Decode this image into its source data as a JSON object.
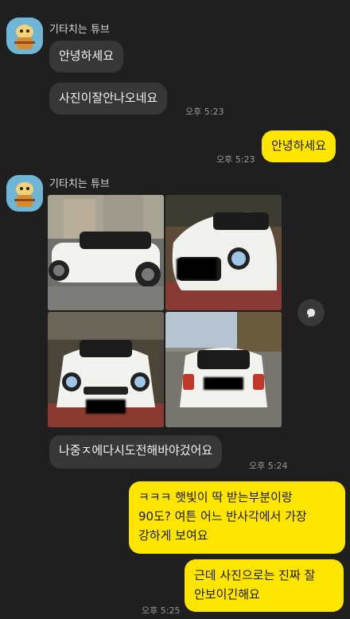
{
  "chat": {
    "sender_name": "기타치는 튜브",
    "colors": {
      "background": "#1f1f1f",
      "incoming_bubble": "#373737",
      "outgoing_bubble": "#fee500",
      "timestamp": "#9a9a9a"
    },
    "messages": [
      {
        "id": "m1",
        "side": "in",
        "text": "안녕하세요"
      },
      {
        "id": "m2",
        "side": "in",
        "text": "사진이잘안나오네요",
        "time": "오후 5:23"
      },
      {
        "id": "m3",
        "side": "out",
        "text": "안녕하세요",
        "time": "오후 5:23"
      },
      {
        "id": "m4",
        "side": "in",
        "type": "photos",
        "count": 4
      },
      {
        "id": "m5",
        "side": "in",
        "text": "나중ㅈ에다시도전해바야겄어요",
        "time": "오후 5:24"
      },
      {
        "id": "m6",
        "side": "out",
        "lines": [
          "ㅋㅋㅋ 햇빛이 딱 받는부분이랑",
          "90도? 여튼 어느 반사각에서 가장",
          "강하게 보여요"
        ]
      },
      {
        "id": "m7",
        "side": "out",
        "lines": [
          "근데 사진으로는 진짜 잘",
          "안보이긴해요"
        ],
        "time": "오후 5:25"
      }
    ]
  }
}
